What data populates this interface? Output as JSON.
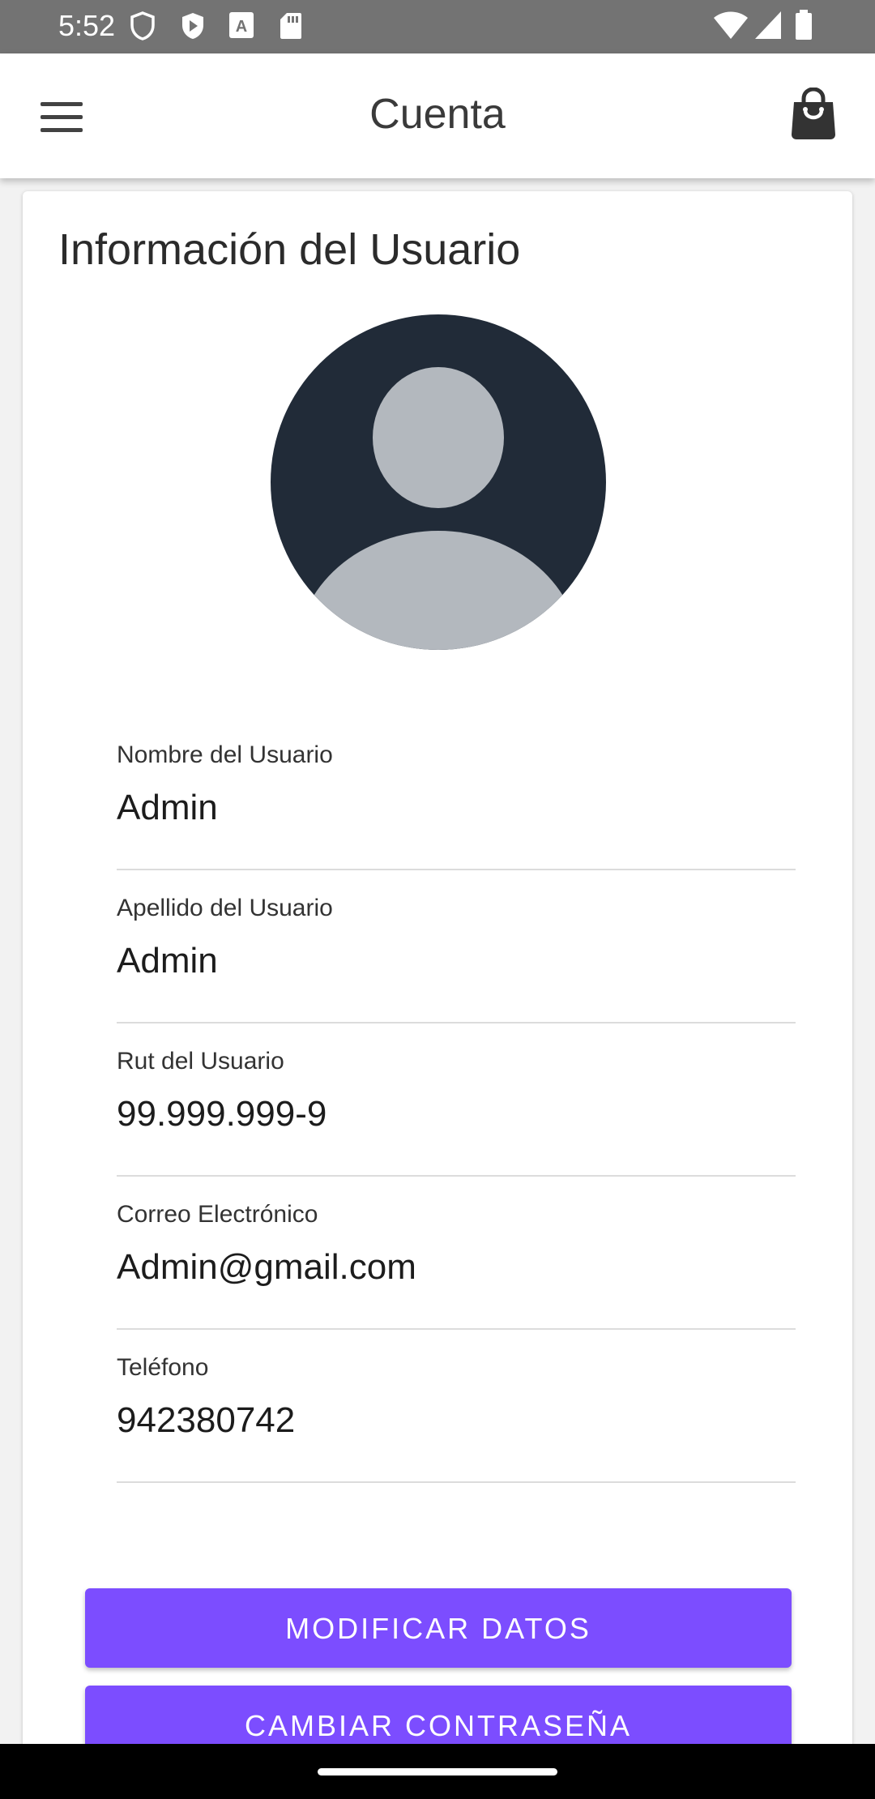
{
  "status_bar": {
    "time": "5:52",
    "icons": [
      "shield-icon",
      "play-protect-icon",
      "font-a-icon",
      "sd-card-icon",
      "wifi-icon",
      "signal-icon",
      "battery-icon"
    ]
  },
  "app_bar": {
    "title": "Cuenta",
    "left_icon": "menu-icon",
    "right_icon": "shopping-bag-icon"
  },
  "card": {
    "title": "Información del Usuario",
    "avatar_icon": "user-avatar-icon",
    "fields": [
      {
        "label": "Nombre del Usuario",
        "value": "Admin"
      },
      {
        "label": "Apellido del Usuario",
        "value": "Admin"
      },
      {
        "label": "Rut del Usuario",
        "value": "99.999.999-9"
      },
      {
        "label": "Correo Electrónico",
        "value": "Admin@gmail.com"
      },
      {
        "label": "Teléfono",
        "value": "942380742"
      }
    ],
    "buttons": {
      "modify": "MODIFICAR DATOS",
      "change_password": "CAMBIAR CONTRASEÑA"
    }
  },
  "colors": {
    "accent": "#7c4dff",
    "status_bar": "#737373",
    "avatar_bg": "#212b38",
    "avatar_fg": "#b3b8be"
  }
}
